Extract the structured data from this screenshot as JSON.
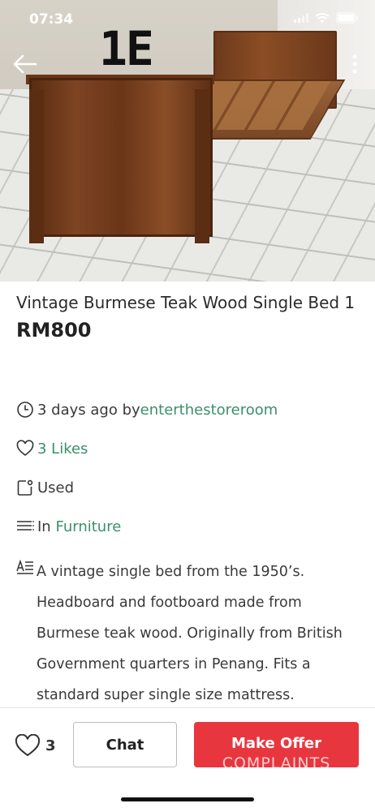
{
  "status_bar": {
    "time": "07:34"
  },
  "photo": {
    "overlay_text": "1E",
    "back_icon": "arrow-left-icon",
    "more_icon": "more-vertical-icon"
  },
  "listing": {
    "title": "Vintage Burmese Teak Wood Single Bed 1",
    "price": "RM800",
    "posted_ago": "3 days ago by ",
    "seller": "enterthestoreroom",
    "likes_text": "3 Likes",
    "condition": "Used",
    "category_prefix": "In ",
    "category": "Furniture",
    "description": "A vintage single bed from the 1950’s. Headboard and footboard made from Burmese teak wood. Originally from British Government quarters in Penang. Fits a standard super single size mattress."
  },
  "bottom_bar": {
    "like_count": "3",
    "chat_label": "Chat",
    "offer_label": "Make Offer",
    "offer_overlay": "COMPLAINTS"
  },
  "colors": {
    "accent_green": "#3b8f6b",
    "offer_red": "#e8363f"
  }
}
